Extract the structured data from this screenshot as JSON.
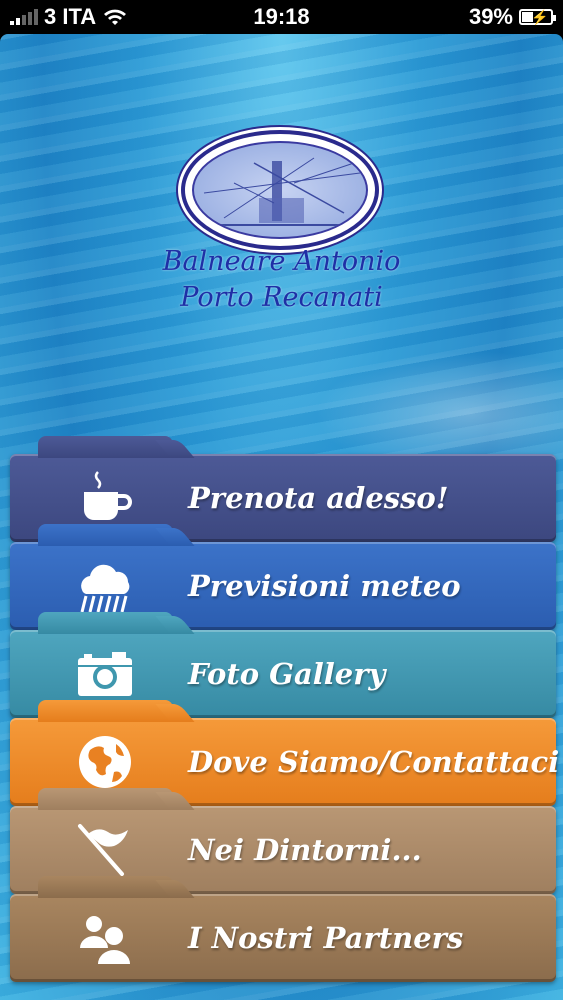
{
  "status_bar": {
    "carrier": "3 ITA",
    "time": "19:18",
    "battery_percent": "39%",
    "battery_level": 0.39,
    "signal_bars": 2
  },
  "brand": {
    "line1": "Balneare Antonio",
    "line2": "Porto Recanati"
  },
  "menu": {
    "items": [
      {
        "label": "Prenota adesso!",
        "icon": "coffee-cup-icon",
        "color": "#45508a"
      },
      {
        "label": "Previsioni meteo",
        "icon": "rain-cloud-icon",
        "color": "#3366bb"
      },
      {
        "label": "Foto Gallery",
        "icon": "camera-icon",
        "color": "#4298b0"
      },
      {
        "label": "Dove Siamo/Contattaci",
        "icon": "globe-icon",
        "color": "#ed8b2a"
      },
      {
        "label": "Nei Dintorni...",
        "icon": "flag-icon",
        "color": "#ac8b69"
      },
      {
        "label": "I Nostri Partners",
        "icon": "people-icon",
        "color": "#9a7856"
      }
    ]
  }
}
